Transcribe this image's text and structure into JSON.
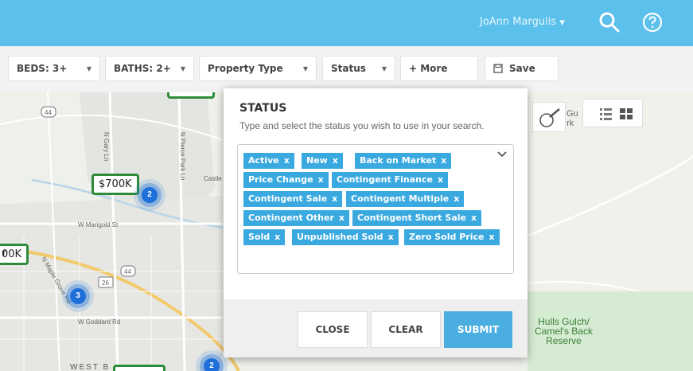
{
  "header": {
    "user_name": "JoAnn Margulis",
    "user_caret": "▼"
  },
  "filters": {
    "beds": "BEDS: 3+",
    "baths": "BATHS: 2+",
    "property_type": "Property Type",
    "status": "Status",
    "more": "+ More",
    "save": "Save"
  },
  "map": {
    "prices": [
      "$700K",
      "00K"
    ],
    "clusters": [
      "2",
      "3",
      "2"
    ],
    "labels": {
      "marigold": "W Marigold St",
      "goddard": "W Goddard Rd",
      "gary": "N Gary Ln",
      "pierce": "N Pierce Park Ln",
      "castle": "Castle",
      "maple": "N Maple Grove Rd",
      "west_b": "WEST B",
      "park": "Hulls Gulch/\nCamel's Back\nReserve",
      "park_line1": "Hulls Gulch/",
      "park_line2": "Camel's Back",
      "park_line3": "Reserve",
      "route44a": "44",
      "route44b": "44",
      "route26": "26",
      "gu": "Gu",
      "rk": "rk",
      "partial_left": "r"
    }
  },
  "status_modal": {
    "title": "STATUS",
    "subtitle": "Type and select the status you wish to use in your search.",
    "tags": [
      "Active",
      "New",
      "Back on Market",
      "Price Change",
      "Contingent Finance",
      "Contingent Sale",
      "Contingent Multiple",
      "Contingent Other",
      "Contingent Short Sale",
      "Sold",
      "Unpublished Sold",
      "Zero Sold Price"
    ],
    "tag_remove": "x",
    "close": "CLOSE",
    "clear": "CLEAR",
    "submit": "SUBMIT"
  },
  "colors": {
    "topbar": "#5bc0eb",
    "tag": "#39a9e0",
    "submit": "#4aaee0",
    "price_border": "#2e8b3a",
    "cluster": "#1e6fd9"
  }
}
